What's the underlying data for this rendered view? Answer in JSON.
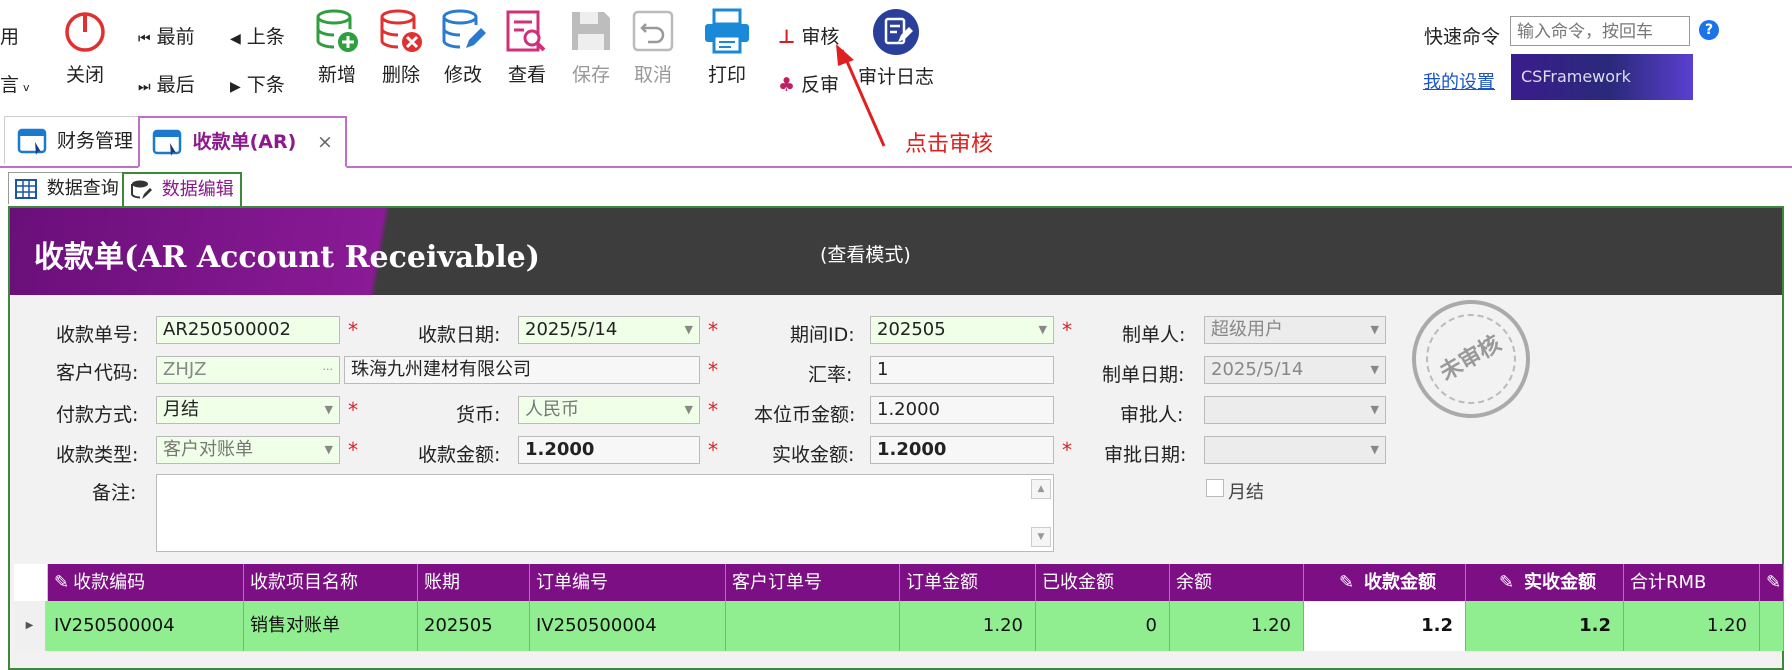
{
  "toolbar": {
    "left_partial_top": "用",
    "left_partial_bottom": "言",
    "close": "关闭",
    "first": "最前",
    "prev": "上条",
    "last": "最后",
    "next": "下条",
    "add": "新增",
    "delete": "删除",
    "edit": "修改",
    "view": "查看",
    "save": "保存",
    "cancel": "取消",
    "print": "打印",
    "approve": "审核",
    "unapprove": "反审",
    "audit_log": "审计日志",
    "quick_command_label": "快速命令",
    "quick_command_placeholder": "输入命令，按回车",
    "help": "?",
    "my_settings": "我的设置",
    "brand": "CSFramework"
  },
  "annotation": "点击审核",
  "doc_tabs": [
    {
      "label": "财务管理"
    },
    {
      "label": "收款单(AR)",
      "close": "×"
    }
  ],
  "sub_tabs": [
    {
      "label": "数据查询"
    },
    {
      "label": "数据编辑"
    }
  ],
  "form": {
    "title": "收款单(AR Account Receivable)",
    "mode": "(查看模式)",
    "stamp": "未审核",
    "fields": {
      "receipt_no_label": "收款单号:",
      "receipt_no": "AR250500002",
      "receipt_date_label": "收款日期:",
      "receipt_date": "2025/5/14",
      "period_label": "期间ID:",
      "period": "202505",
      "creator_label": "制单人:",
      "creator": "超级用户",
      "customer_code_label": "客户代码:",
      "customer_code": "ZHJZ",
      "customer_name": "珠海九州建材有限公司",
      "rate_label": "汇率:",
      "rate": "1",
      "create_date_label": "制单日期:",
      "create_date": "2025/5/14",
      "pay_method_label": "付款方式:",
      "pay_method": "月结",
      "currency_label": "货币:",
      "currency": "人民币",
      "local_amount_label": "本位币金额:",
      "local_amount": "1.2000",
      "approver_label": "审批人:",
      "approver": "",
      "receipt_type_label": "收款类型:",
      "receipt_type": "客户对账单",
      "receipt_amount_label": "收款金额:",
      "receipt_amount": "1.2000",
      "actual_amount_label": "实收金额:",
      "actual_amount": "1.2000",
      "approve_date_label": "审批日期:",
      "approve_date": "",
      "monthly_label": "月结",
      "remark_label": "备注:"
    }
  },
  "grid": {
    "columns": [
      "收款编码",
      "收款项目名称",
      "账期",
      "订单编号",
      "客户订单号",
      "订单金额",
      "已收金额",
      "余额",
      "收款金额",
      "实收金额",
      "合计RMB"
    ],
    "rows": [
      [
        "IV250500004",
        "销售对账单",
        "202505",
        "IV250500004",
        "",
        "1.20",
        "0",
        "1.20",
        "1.2",
        "1.2",
        "1.20"
      ]
    ]
  }
}
